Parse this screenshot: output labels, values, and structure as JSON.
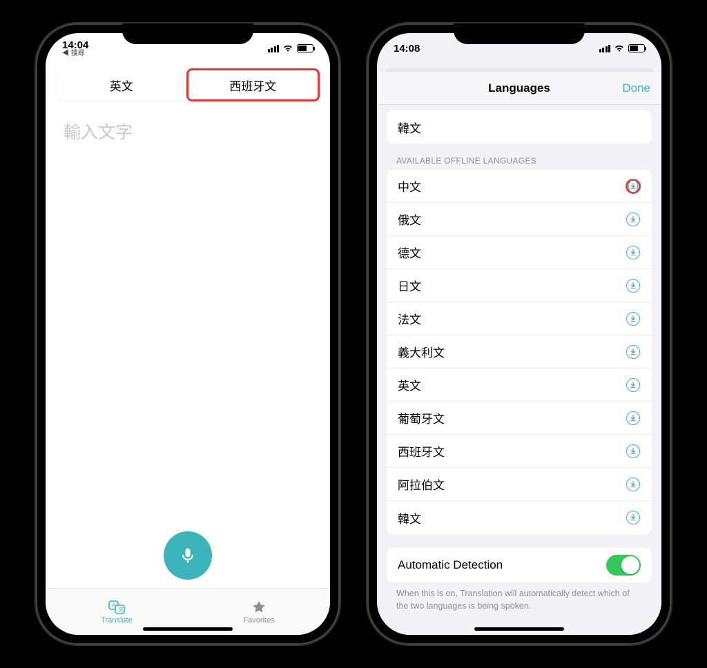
{
  "phone1": {
    "status": {
      "time": "14:04",
      "subtext": "◀ 搜尋"
    },
    "lang_left": "英文",
    "lang_right": "西班牙文",
    "input_placeholder": "輸入文字",
    "tabs": {
      "translate": "Translate",
      "favorites": "Favorites"
    }
  },
  "phone2": {
    "status": {
      "time": "14:08"
    },
    "sheet": {
      "title": "Languages",
      "done": "Done"
    },
    "top_row": "韓文",
    "section_header": "AVAILABLE OFFLINE LANGUAGES",
    "offline": [
      "中文",
      "俄文",
      "德文",
      "日文",
      "法文",
      "義大利文",
      "英文",
      "葡萄牙文",
      "西班牙文",
      "阿拉伯文",
      "韓文"
    ],
    "auto_detect_label": "Automatic Detection",
    "footer": "When this is on, Translation will automatically detect which of the two languages is being spoken."
  }
}
